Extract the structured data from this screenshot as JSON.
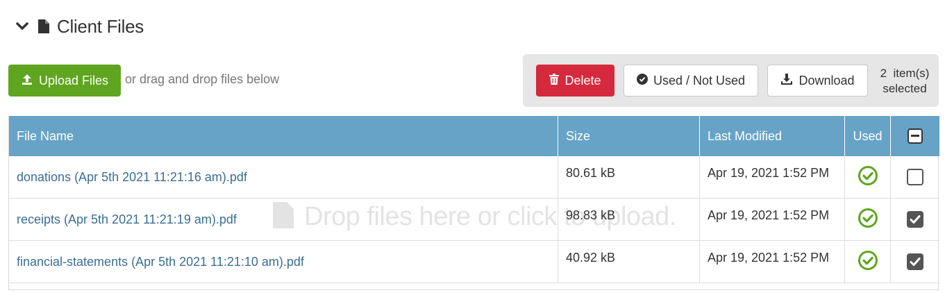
{
  "section": {
    "title": "Client Files",
    "collapse_icon": "chevron-down-icon",
    "file_icon": "file-icon"
  },
  "upload": {
    "button_label": "Upload Files",
    "icon": "upload-icon",
    "hint": "or drag and drop files below"
  },
  "actions": {
    "delete_label": "Delete",
    "used_label": "Used / Not Used",
    "download_label": "Download",
    "selected_count": "2",
    "selected_suffix": "item(s)",
    "selected_text": "selected"
  },
  "table": {
    "columns": [
      "File Name",
      "Size",
      "Last Modified",
      "Used"
    ],
    "rows": [
      {
        "name": "donations (Apr 5th 2021 11:21:16 am).pdf",
        "size": "80.61 kB",
        "modified": "Apr 19, 2021 1:52 PM",
        "used": true,
        "checked": false
      },
      {
        "name": "receipts (Apr 5th 2021 11:21:19 am).pdf",
        "size": "98.83 kB",
        "modified": "Apr 19, 2021 1:52 PM",
        "used": true,
        "checked": true
      },
      {
        "name": "financial-statements (Apr 5th 2021 11:21:10 am).pdf",
        "size": "40.92 kB",
        "modified": "Apr 19, 2021 1:52 PM",
        "used": true,
        "checked": true
      }
    ]
  },
  "dropzone": {
    "text": "Drop files here or click to upload."
  },
  "colors": {
    "header_bg": "#66a3c7",
    "upload_green": "#5fa51f",
    "delete_red": "#d5293e",
    "used_green": "#5fa51f",
    "link_blue": "#3a6e92"
  }
}
